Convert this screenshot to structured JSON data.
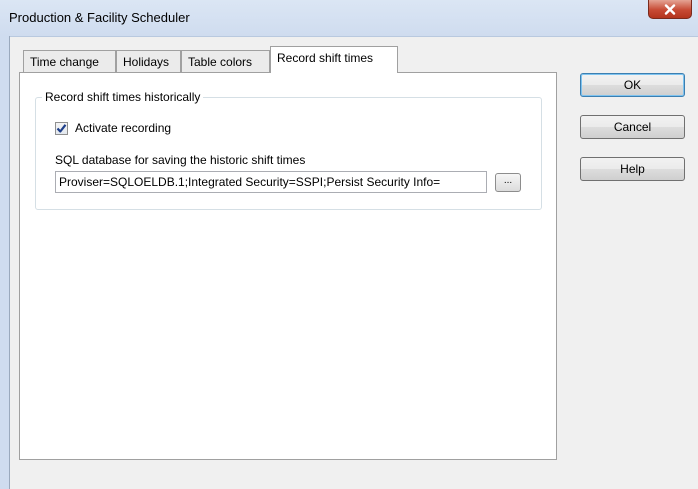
{
  "window": {
    "title": "Production & Facility Scheduler"
  },
  "tabs": [
    {
      "label": "Time change",
      "active": false
    },
    {
      "label": "Holidays",
      "active": false
    },
    {
      "label": "Table colors",
      "active": false
    },
    {
      "label": "Record shift times",
      "active": true
    }
  ],
  "panel": {
    "group_title": "Record shift times historically",
    "activate_recording": {
      "label": "Activate recording",
      "checked": true
    },
    "sql_label": "SQL database for saving the historic shift times",
    "sql_value": "Proviser=SQLOELDB.1;Integrated Security=SSPI;Persist Security Info=",
    "browse_label": "..."
  },
  "buttons": {
    "ok": "OK",
    "cancel": "Cancel",
    "help": "Help"
  },
  "icons": {
    "close": "close-icon",
    "check": "checkmark-icon"
  },
  "colors": {
    "titlebar": "#cfdcef",
    "close_button": "#c74a34",
    "check_mark": "#1f3f8a"
  }
}
